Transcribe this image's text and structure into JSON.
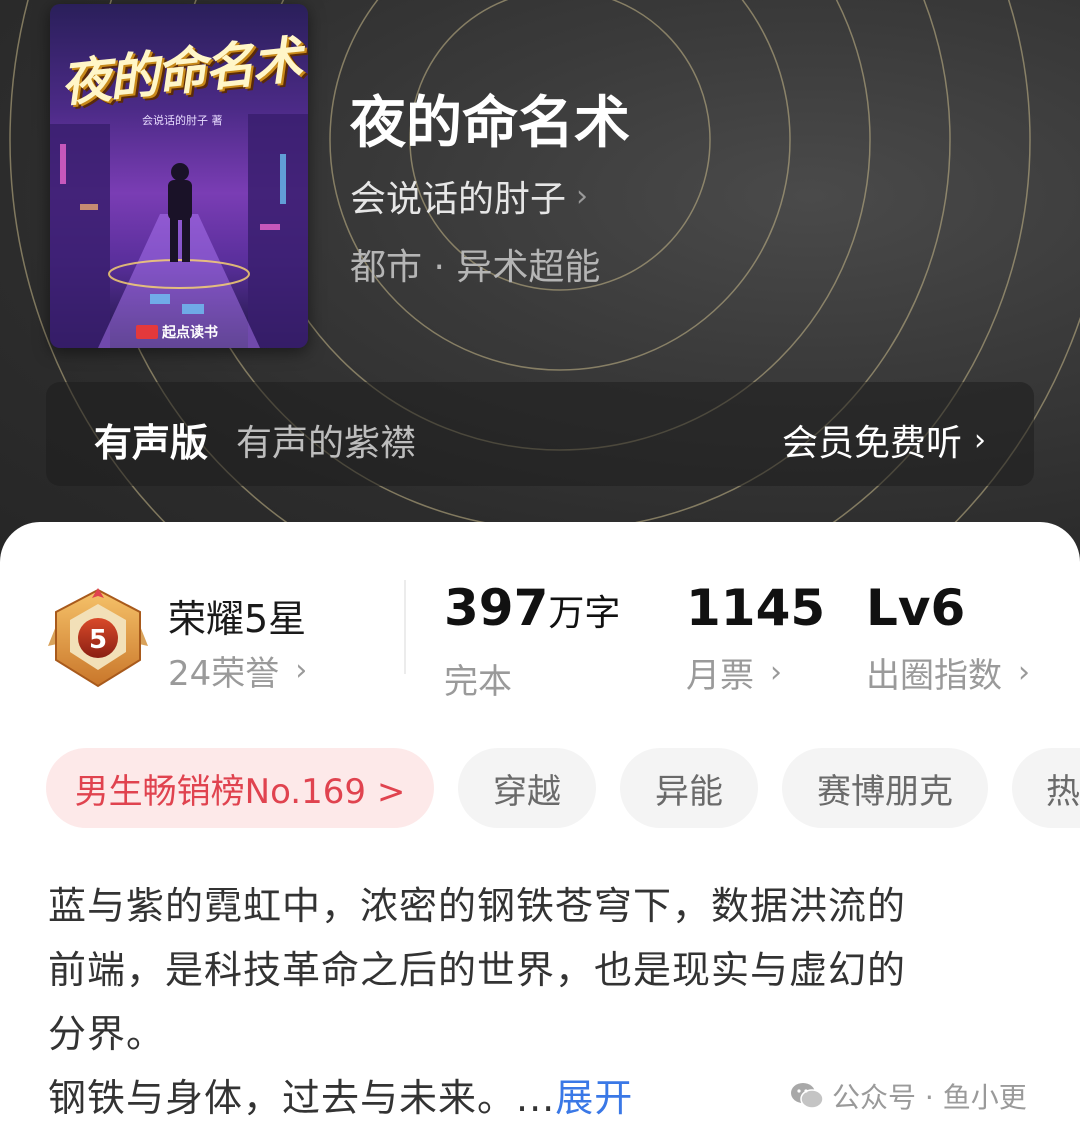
{
  "book": {
    "title": "夜的命名术",
    "author": "会说话的肘子",
    "genre": "都市 · 异术超能",
    "cover": {
      "title_art": "夜的命名术",
      "author_line": "会说话的肘子 著",
      "publisher": "起点读书"
    }
  },
  "audio": {
    "label": "有声版",
    "narrator": "有声的紫襟",
    "action": "会员免费听"
  },
  "honor": {
    "title": "荣耀5星",
    "subtitle": "24荣誉",
    "medal_number": "5"
  },
  "stats": [
    {
      "value": "397",
      "unit": "万字",
      "label": "完本",
      "has_arrow": false
    },
    {
      "value": "1145",
      "unit": "",
      "label": "月票",
      "has_arrow": true
    },
    {
      "value": "Lv6",
      "unit": "",
      "label": "出圈指数",
      "has_arrow": true
    }
  ],
  "tags": [
    {
      "label": "男生畅销榜No.169 >",
      "type": "rank"
    },
    {
      "label": "穿越",
      "type": "normal"
    },
    {
      "label": "异能",
      "type": "normal"
    },
    {
      "label": "赛博朋克",
      "type": "normal"
    },
    {
      "label": "热",
      "type": "normal"
    }
  ],
  "synopsis": {
    "lines": [
      "蓝与紫的霓虹中，浓密的钢铁苍穹下，数据洪流的",
      "前端，是科技革命之后的世界，也是现实与虚幻的",
      "分界。",
      "钢铁与身体，过去与未来。..."
    ],
    "expand_label": "展开"
  },
  "watermark": "公众号 · 鱼小更",
  "colors": {
    "rank_text": "#e0434f",
    "rank_bg": "#fde9e9",
    "link": "#3a78e6",
    "header_bg": "#2f2f2f"
  },
  "icons": [
    "chevron-right-icon",
    "medal-icon",
    "wechat-icon"
  ]
}
